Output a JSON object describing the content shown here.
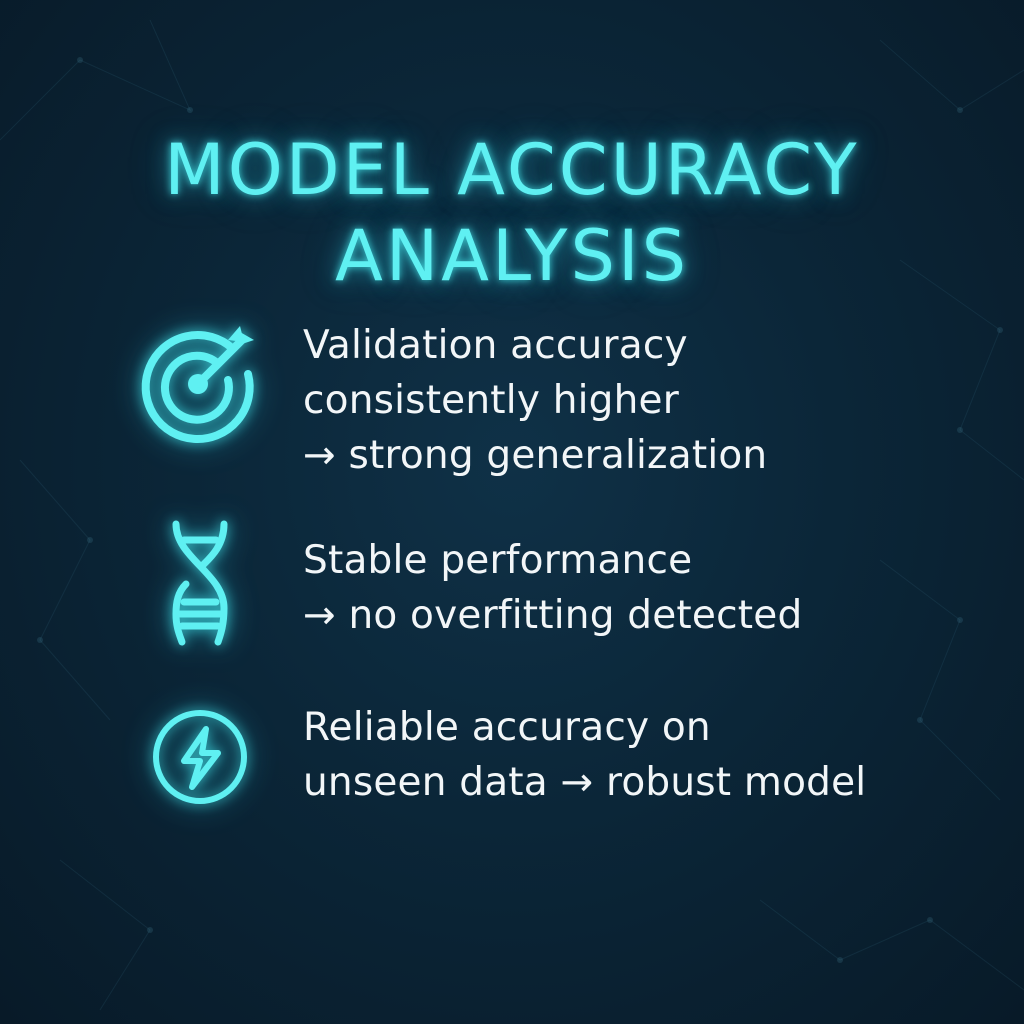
{
  "title": {
    "line1": "MODEL ACCURACY",
    "line2": "ANALYSIS"
  },
  "colors": {
    "accent": "#5ff0f2",
    "text": "#f2f6f8",
    "background": "#0b2638"
  },
  "items": [
    {
      "icon": "target-arrow-icon",
      "lines": [
        "Validation accuracy",
        "consistently higher",
        "→ strong generalization"
      ]
    },
    {
      "icon": "dna-icon",
      "lines": [
        "Stable performance",
        "→ no overfitting detected"
      ]
    },
    {
      "icon": "lightning-bolt-icon",
      "lines": [
        "Reliable accuracy on",
        "unseen data → robust model"
      ]
    }
  ]
}
